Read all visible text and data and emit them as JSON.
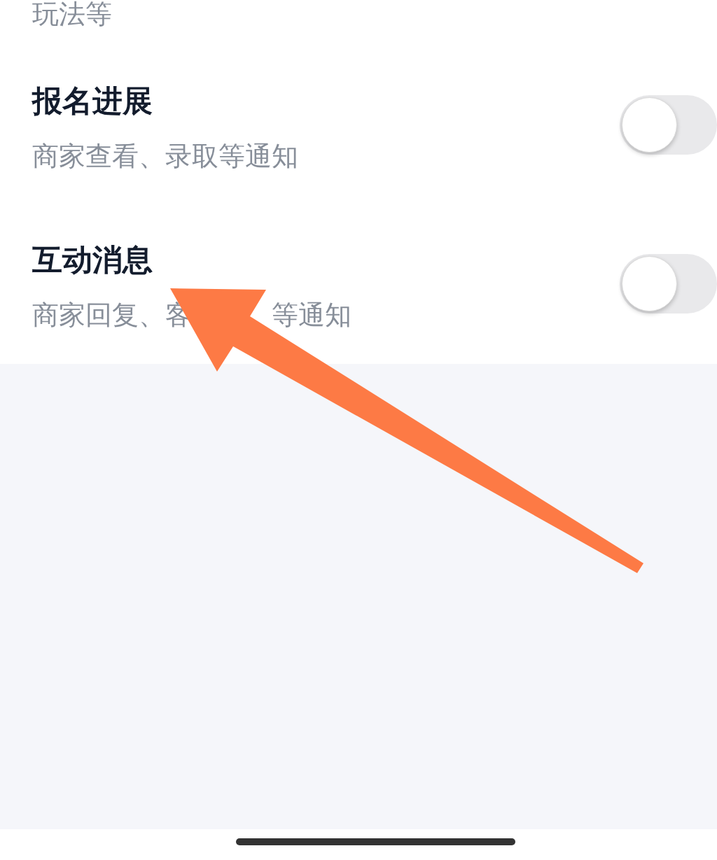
{
  "settings": {
    "cut_subtitle": "玩法等",
    "items": [
      {
        "title": "报名进展",
        "subtitle_parts": [
          "商家查看、录取等通知"
        ],
        "on": false
      },
      {
        "title": "互动消息",
        "subtitle_parts": [
          "商家回复、客",
          "等通知"
        ],
        "on": false
      }
    ]
  }
}
